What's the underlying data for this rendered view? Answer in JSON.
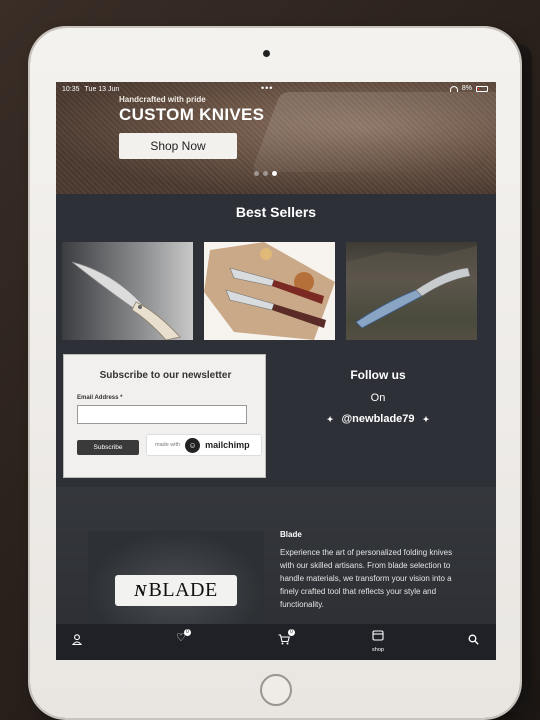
{
  "status_bar": {
    "time": "10:35",
    "date": "Tue 13 Jun",
    "dots": "•••",
    "battery": "8%"
  },
  "hero": {
    "kicker": "Handcrafted with pride",
    "title": "CUSTOM KNIVES",
    "cta_label": "Shop Now",
    "slide_count": 3,
    "active_slide": 3
  },
  "best_sellers": {
    "title": "Best Sellers",
    "products": [
      {
        "image": "folding-clip-point-knife-wood-handle"
      },
      {
        "image": "two-knives-on-leather-with-wood"
      },
      {
        "image": "knife-on-rock-outdoors"
      }
    ]
  },
  "newsletter": {
    "title": "Subscribe to our newsletter",
    "email_label": "Email Address",
    "required_marker": "*",
    "email_value": "",
    "subscribe_label": "Subscribe",
    "made_with": "made with",
    "brand": "mailchimp"
  },
  "follow": {
    "title": "Follow us",
    "on": "On",
    "handle": "@newblade79",
    "sparkle": "✦"
  },
  "about": {
    "logo_mark": "N",
    "logo_text": "BLADE",
    "heading": "Blade",
    "text": "Experience the art of personalized folding knives with our skilled artisans. From blade selection to handle materials, we transform your vision into a finely crafted tool that reflects your style and functionality."
  },
  "bottom_nav": {
    "account_icon": "user-icon",
    "wishlist_icon": "heart-icon",
    "wishlist_count": "0",
    "cart_icon": "cart-icon",
    "cart_count": "0",
    "shop_icon": "shop-icon",
    "shop_label": "shop",
    "search_icon": "search-icon"
  },
  "colors": {
    "page_bg": "#2d3036",
    "nav_bg": "#1f2126",
    "panel_bg": "#f1f0ef"
  }
}
